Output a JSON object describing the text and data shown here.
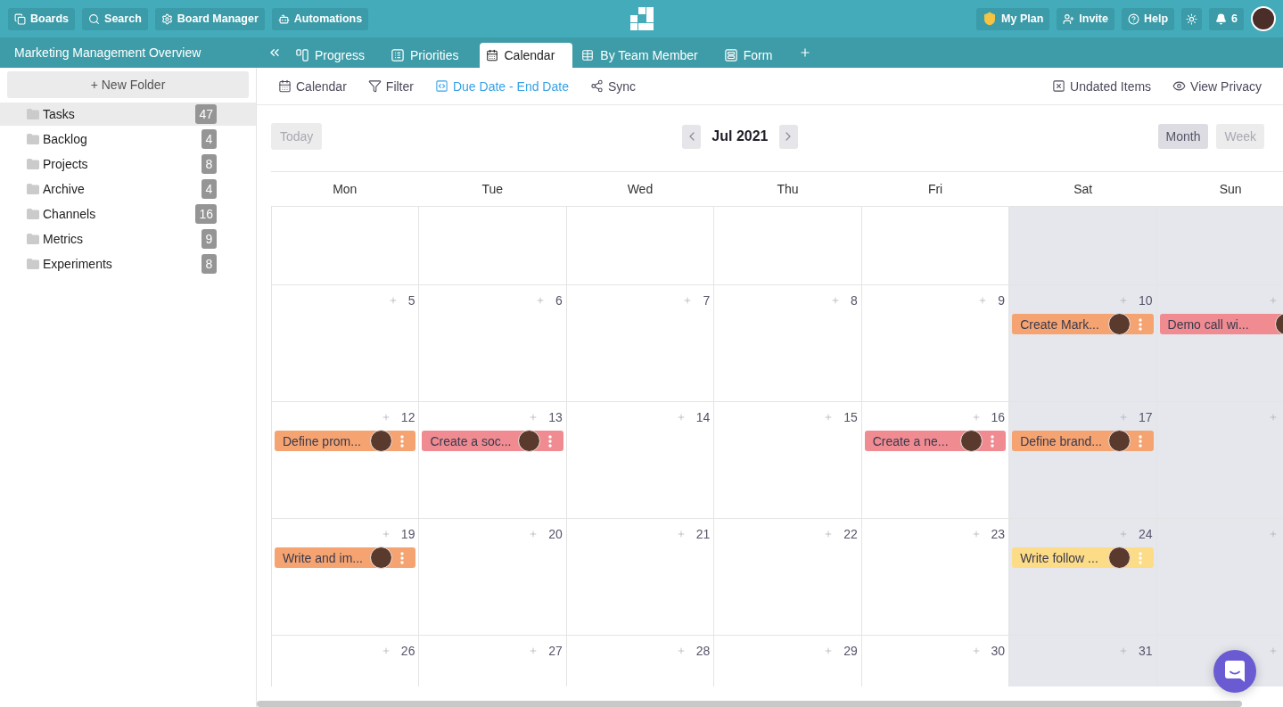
{
  "top_bar": {
    "left_buttons": [
      {
        "kind": "boards",
        "label": "Boards"
      },
      {
        "kind": "search",
        "label": "Search"
      },
      {
        "kind": "settings",
        "label": "Board Manager"
      },
      {
        "kind": "automations",
        "label": "Automations"
      }
    ],
    "right_buttons": [
      {
        "kind": "plan",
        "label": "My Plan"
      },
      {
        "kind": "invite",
        "label": "Invite"
      },
      {
        "kind": "help",
        "label": "Help"
      },
      {
        "kind": "theme"
      },
      {
        "kind": "notifications",
        "label": "6"
      }
    ]
  },
  "board_title": "Marketing Management Overview",
  "tabs": [
    {
      "kind": "progress",
      "label": "Progress",
      "selected": false
    },
    {
      "kind": "priorities",
      "label": "Priorities",
      "selected": false
    },
    {
      "kind": "calendar",
      "label": "Calendar",
      "selected": true
    },
    {
      "kind": "table",
      "label": "By Team Member",
      "selected": false
    },
    {
      "kind": "form",
      "label": "Form",
      "selected": false
    }
  ],
  "sidebar": {
    "new_folder": "+ New Folder",
    "folders": [
      {
        "label": "Tasks",
        "count": "47",
        "selected": true
      },
      {
        "label": "Backlog",
        "count": "4",
        "selected": false
      },
      {
        "label": "Projects",
        "count": "8",
        "selected": false
      },
      {
        "label": "Archive",
        "count": "4",
        "selected": false
      },
      {
        "label": "Channels",
        "count": "16",
        "selected": false
      },
      {
        "label": "Metrics",
        "count": "9",
        "selected": false
      },
      {
        "label": "Experiments",
        "count": "8",
        "selected": false
      }
    ]
  },
  "toolbar": {
    "left": [
      {
        "kind": "calendar",
        "label": "Calendar",
        "active": false
      },
      {
        "kind": "filter",
        "label": "Filter",
        "active": false
      },
      {
        "kind": "date_field",
        "label": "Due Date - End Date",
        "active": true
      },
      {
        "kind": "sync",
        "label": "Sync",
        "active": false
      }
    ],
    "right": [
      {
        "kind": "undated",
        "label": "Undated Items",
        "active": false
      },
      {
        "kind": "privacy",
        "label": "View Privacy",
        "active": false
      }
    ]
  },
  "calendar": {
    "today": {
      "label": "Today",
      "disabled": true
    },
    "month": "Jul 2021",
    "views": [
      {
        "label": "Month",
        "selected": true
      },
      {
        "label": "Week",
        "selected": false
      }
    ],
    "columns": [
      {
        "label": "Mon",
        "weekend": false
      },
      {
        "label": "Tue",
        "weekend": false
      },
      {
        "label": "Wed",
        "weekend": false
      },
      {
        "label": "Thu",
        "weekend": false
      },
      {
        "label": "Fri",
        "weekend": false
      },
      {
        "label": "Sat",
        "weekend": true
      },
      {
        "label": "Sun",
        "weekend": true
      }
    ],
    "weeks": [
      {
        "days": [
          {
            "addable": false
          },
          {
            "addable": false
          },
          {
            "addable": false
          },
          {
            "addable": false
          },
          {
            "addable": false
          },
          {
            "addable": false
          },
          {
            "addable": false
          }
        ]
      },
      {
        "days": [
          {
            "addable": true,
            "date": "5"
          },
          {
            "addable": true,
            "date": "6"
          },
          {
            "addable": true,
            "date": "7"
          },
          {
            "addable": true,
            "date": "8"
          },
          {
            "addable": true,
            "date": "9"
          },
          {
            "addable": true,
            "date": "10",
            "events": [
              {
                "title": "Create Mark...",
                "color": "#f4a371",
                "menu": true
              }
            ]
          },
          {
            "addable": true,
            "events": [
              {
                "title": "Demo call wi...",
                "color": "#ef8b91",
                "menu": false
              }
            ]
          }
        ]
      },
      {
        "days": [
          {
            "addable": true,
            "date": "12",
            "events": [
              {
                "title": "Define prom...",
                "color": "#f4a371",
                "menu": true
              }
            ]
          },
          {
            "addable": true,
            "date": "13",
            "events": [
              {
                "title": "Create a soc...",
                "color": "#ef8b91",
                "menu": true
              }
            ]
          },
          {
            "addable": true,
            "date": "14"
          },
          {
            "addable": true,
            "date": "15"
          },
          {
            "addable": true,
            "date": "16",
            "events": [
              {
                "title": "Create a ne...",
                "color": "#ef8b91",
                "menu": true
              }
            ]
          },
          {
            "addable": true,
            "date": "17",
            "events": [
              {
                "title": "Define brand...",
                "color": "#f4a371",
                "menu": true
              }
            ]
          },
          {
            "addable": true
          }
        ]
      },
      {
        "days": [
          {
            "addable": true,
            "date": "19",
            "events": [
              {
                "title": "Write and im...",
                "color": "#f4a371",
                "menu": true
              }
            ]
          },
          {
            "addable": true,
            "date": "20"
          },
          {
            "addable": true,
            "date": "21"
          },
          {
            "addable": true,
            "date": "22"
          },
          {
            "addable": true,
            "date": "23"
          },
          {
            "addable": true,
            "date": "24",
            "events": [
              {
                "title": "Write follow ...",
                "color": "#fcdc87",
                "menu": true
              }
            ]
          },
          {
            "addable": true
          }
        ]
      },
      {
        "days": [
          {
            "addable": true,
            "date": "26"
          },
          {
            "addable": true,
            "date": "27"
          },
          {
            "addable": true,
            "date": "28"
          },
          {
            "addable": true,
            "date": "29"
          },
          {
            "addable": true,
            "date": "30"
          },
          {
            "addable": true,
            "date": "31"
          },
          {
            "addable": true
          }
        ]
      }
    ]
  }
}
